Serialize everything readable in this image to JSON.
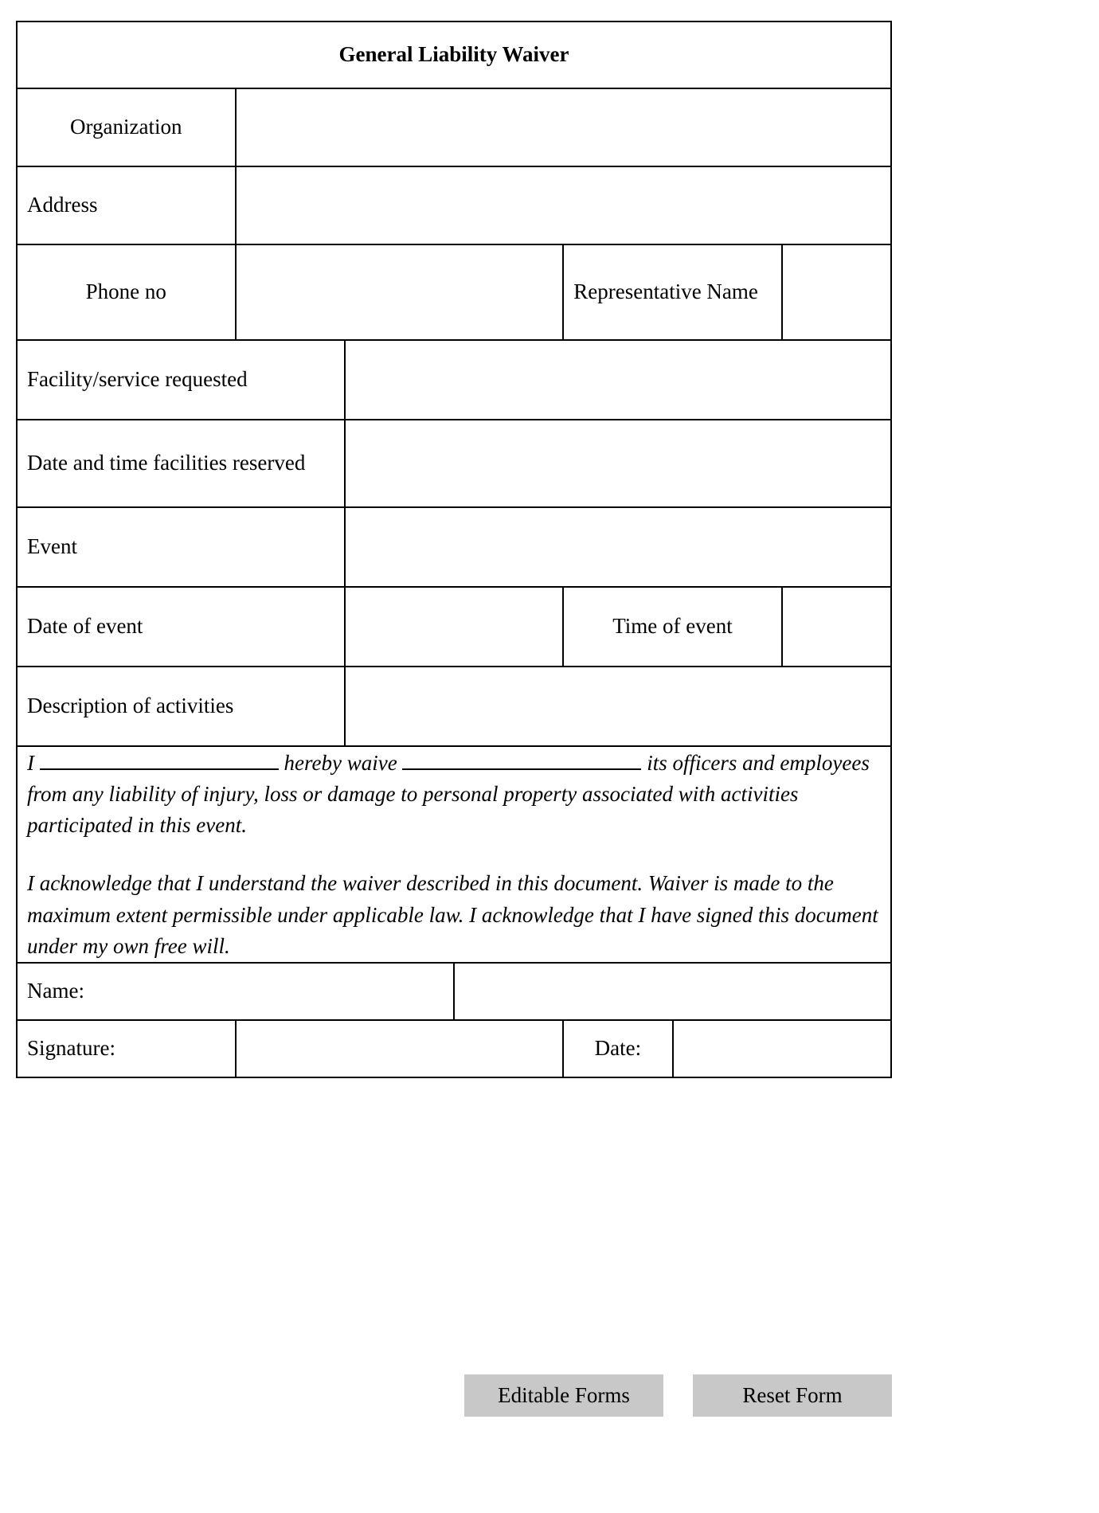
{
  "document": {
    "title": "General Liability Waiver"
  },
  "fields": {
    "organization": {
      "label": "Organization",
      "value": ""
    },
    "address": {
      "label": "Address",
      "value": ""
    },
    "phone_no": {
      "label": "Phone no",
      "value": ""
    },
    "representative_name": {
      "label": "Representative Name",
      "value": ""
    },
    "facility_service_requested": {
      "label": "Facility/service requested",
      "value": ""
    },
    "date_time_reserved": {
      "label": "Date and time facilities reserved",
      "value": ""
    },
    "event": {
      "label": "Event",
      "value": ""
    },
    "date_of_event": {
      "label": "Date of event",
      "value": ""
    },
    "time_of_event": {
      "label": "Time of event",
      "value": ""
    },
    "description_of_activities": {
      "label": "Description of activities",
      "value": ""
    },
    "name": {
      "label": "Name:",
      "value": ""
    },
    "signature": {
      "label": "Signature:",
      "value": ""
    },
    "date": {
      "label": "Date:",
      "value": ""
    }
  },
  "waiver": {
    "line1_prefix": "I",
    "line1_mid": "hereby waive",
    "line1_suffix": "its officers and employees from any liability of injury, loss or damage to personal property associated with activities participated in this event.",
    "paragraph2": "I acknowledge that I understand the waiver described in this document. Waiver is made to the maximum extent permissible under applicable law. I acknowledge that I have signed this document under my own free will.",
    "blank_name_value": "",
    "blank_org_value": ""
  },
  "buttons": {
    "editable_forms": "Editable Forms",
    "reset_form": "Reset Form"
  },
  "colors": {
    "header_blue": "#96b3d9",
    "cell_blue": "#b3c6e2",
    "button_gray": "#c8c8c8",
    "border": "#000000"
  }
}
